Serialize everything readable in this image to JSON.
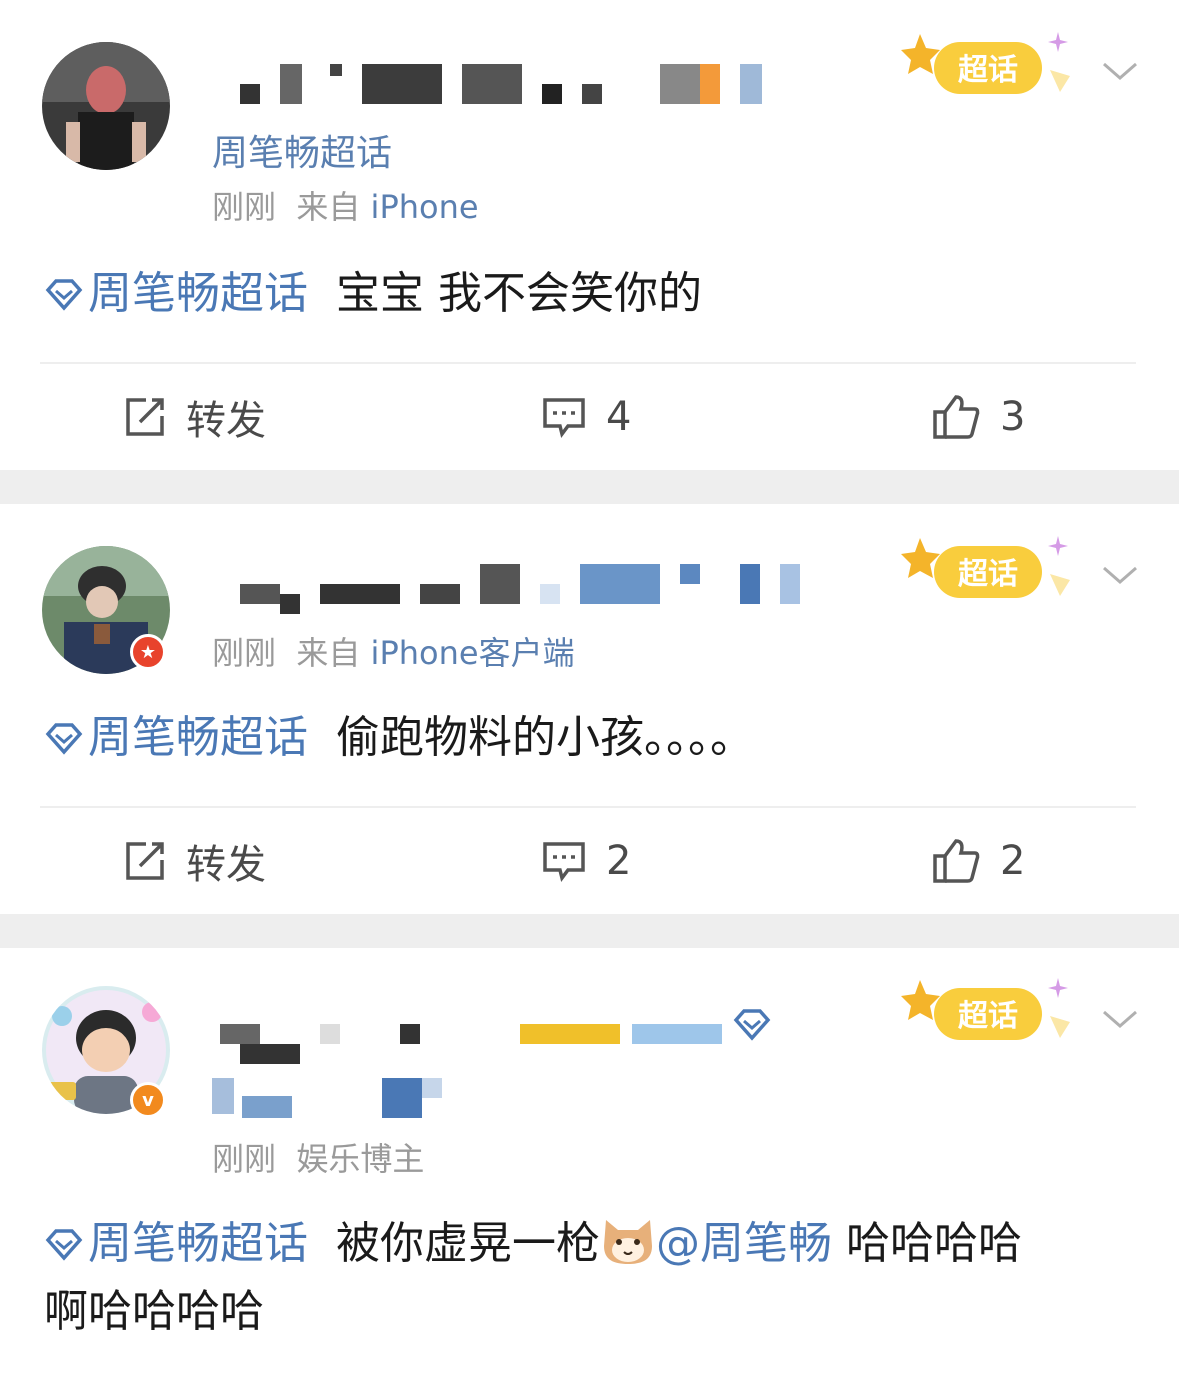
{
  "posts": [
    {
      "topic_line": "周笔畅超话",
      "meta_time": "刚刚",
      "meta_from": "来自",
      "meta_source": "iPhone",
      "topic": "周笔畅超话",
      "text": "宝宝 我不会笑你的",
      "repost_label": "转发",
      "comment_count": "4",
      "like_count": "3",
      "badge_label": "超话"
    },
    {
      "meta_time": "刚刚",
      "meta_from": "来自",
      "meta_source": "iPhone客户端",
      "topic": "周笔畅超话",
      "text": "偷跑物料的小孩。。。。",
      "repost_label": "转发",
      "comment_count": "2",
      "like_count": "2",
      "badge_label": "超话"
    },
    {
      "meta_time": "刚刚",
      "meta_role": "娱乐博主",
      "topic": "周笔畅超话",
      "text_a": "被你虚晃一枪",
      "mention": "@周笔畅",
      "text_b": " 哈哈哈哈",
      "text_c": "啊哈哈哈哈",
      "badge_label": "超话"
    }
  ],
  "colors": {
    "link": "#4a78b5",
    "meta": "#9a9a9a",
    "separator": "#eeeeee",
    "badge": "#f7c42a"
  }
}
